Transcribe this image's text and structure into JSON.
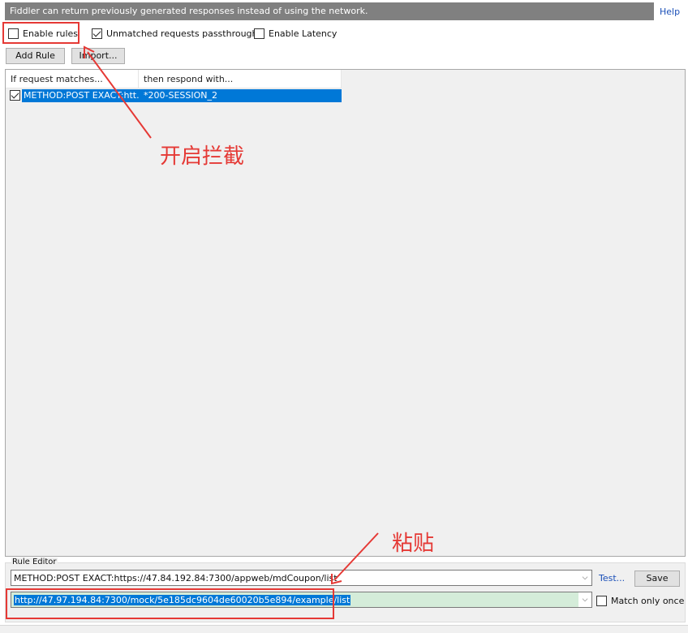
{
  "banner": {
    "text": "Fiddler can return previously generated responses instead of using the network.",
    "help": "Help"
  },
  "options": {
    "enable_rules": {
      "label": "Enable rules",
      "checked": false
    },
    "unmatched_passthrough": {
      "label": "Unmatched requests passthrough",
      "checked": true
    },
    "enable_latency": {
      "label": "Enable Latency",
      "checked": false
    }
  },
  "toolbar": {
    "add_rule": "Add Rule",
    "import": "Import..."
  },
  "rules_list": {
    "columns": [
      "If request matches...",
      "then respond with..."
    ],
    "rows": [
      {
        "checked": true,
        "match": "METHOD:POST EXACT:htt...",
        "respond": "*200-SESSION_2",
        "selected": true
      }
    ]
  },
  "rule_editor": {
    "label": "Rule Editor",
    "match_value": "METHOD:POST EXACT:https://47.84.192.84:7300/appweb/mdCoupon/list",
    "response_value": "http://47.97.194.84:7300/mock/5e185dc9604de60020b5e894/example/list",
    "test_link": "Test...",
    "save": "Save",
    "match_once": {
      "label": "Match only once",
      "checked": false
    }
  },
  "annotations": {
    "enable_note": "开启拦截",
    "paste_note": "粘贴",
    "color": "#e53935"
  }
}
